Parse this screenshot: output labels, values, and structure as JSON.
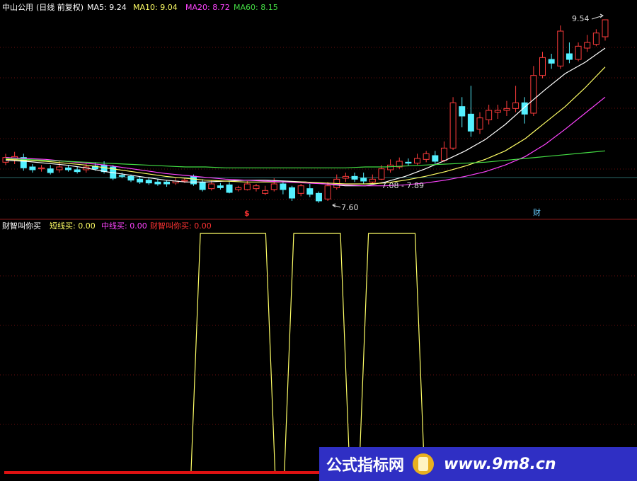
{
  "header": {
    "stock": "中山公用",
    "mode": "(日线 前复权)",
    "ma": [
      {
        "label": "MA5:",
        "value": "9.24",
        "color": "#ffffff"
      },
      {
        "label": "MA10:",
        "value": "9.04",
        "color": "#ffff66"
      },
      {
        "label": "MA20:",
        "value": "8.72",
        "color": "#ff44ff"
      },
      {
        "label": "MA60:",
        "value": "8.15",
        "color": "#44dd44"
      }
    ]
  },
  "indicator_header": {
    "name": "财智叫你买",
    "items": [
      {
        "label": "短线买:",
        "value": "0.00",
        "color": "#ffff66"
      },
      {
        "label": "中线买:",
        "value": "0.00",
        "color": "#ff44ff"
      },
      {
        "label": "财智叫你买:",
        "value": "0.00",
        "color": "#ff3333"
      }
    ]
  },
  "annotations": {
    "high": "9.54",
    "low": "7.60",
    "range": "7.08 - 7.89",
    "marker_sell": "$",
    "marker_buy": "财"
  },
  "watermark": {
    "cn": "公式指标网",
    "url": "www.9m8.cn"
  },
  "chart_data": [
    {
      "type": "line",
      "title": "中山公用 (日线 前复权)",
      "series": [
        {
          "name": "MA5",
          "color": "#ffffff",
          "values": [
            8.05,
            8.04,
            8.02,
            8.0,
            7.97,
            7.93,
            7.9,
            7.87,
            7.84,
            7.82,
            7.82,
            7.83,
            7.84,
            7.84,
            7.83,
            7.82,
            7.8,
            7.78,
            7.78,
            7.82,
            7.88,
            7.96,
            8.05,
            8.15,
            8.27,
            8.43,
            8.62,
            8.8,
            8.97,
            9.09,
            9.24
          ]
        },
        {
          "name": "MA10",
          "color": "#ffff66",
          "values": [
            8.06,
            8.05,
            8.04,
            8.02,
            8.0,
            7.97,
            7.94,
            7.91,
            7.88,
            7.86,
            7.84,
            7.83,
            7.82,
            7.82,
            7.82,
            7.82,
            7.81,
            7.8,
            7.8,
            7.81,
            7.84,
            7.88,
            7.93,
            7.99,
            8.06,
            8.15,
            8.28,
            8.45,
            8.62,
            8.82,
            9.04
          ]
        },
        {
          "name": "MA20",
          "color": "#ff44ff",
          "values": [
            8.08,
            8.07,
            8.06,
            8.04,
            8.02,
            8.0,
            7.97,
            7.94,
            7.91,
            7.89,
            7.87,
            7.85,
            7.84,
            7.83,
            7.82,
            7.81,
            7.8,
            7.79,
            7.78,
            7.78,
            7.79,
            7.81,
            7.84,
            7.88,
            7.93,
            8.0,
            8.09,
            8.22,
            8.38,
            8.55,
            8.72
          ]
        },
        {
          "name": "MA60",
          "color": "#44dd44",
          "values": [
            8.07,
            8.06,
            8.05,
            8.04,
            8.03,
            8.02,
            8.01,
            8.0,
            7.99,
            7.98,
            7.98,
            7.97,
            7.97,
            7.97,
            7.97,
            7.97,
            7.97,
            7.97,
            7.98,
            7.98,
            7.99,
            8.0,
            8.01,
            8.02,
            8.03,
            8.05,
            8.07,
            8.09,
            8.11,
            8.13,
            8.15
          ]
        }
      ],
      "candles": [
        [
          8.03,
          8.08,
          8.12,
          8.0
        ],
        [
          8.06,
          8.09,
          8.14,
          8.01
        ],
        [
          8.08,
          7.97,
          8.12,
          7.94
        ],
        [
          7.98,
          7.95,
          8.01,
          7.92
        ],
        [
          7.96,
          7.97,
          8.0,
          7.93
        ],
        [
          7.96,
          7.92,
          8.0,
          7.9
        ],
        [
          7.95,
          7.98,
          8.04,
          7.92
        ],
        [
          7.97,
          7.95,
          8.0,
          7.93
        ],
        [
          7.95,
          7.93,
          7.98,
          7.91
        ],
        [
          7.95,
          7.98,
          8.02,
          7.92
        ],
        [
          7.99,
          7.96,
          8.03,
          7.94
        ],
        [
          8.0,
          7.93,
          8.04,
          7.91
        ],
        [
          7.98,
          7.86,
          8.0,
          7.84
        ],
        [
          7.89,
          7.88,
          7.92,
          7.86
        ],
        [
          7.88,
          7.84,
          7.9,
          7.82
        ],
        [
          7.85,
          7.82,
          7.88,
          7.8
        ],
        [
          7.84,
          7.81,
          7.87,
          7.79
        ],
        [
          7.82,
          7.8,
          7.85,
          7.78
        ],
        [
          7.82,
          7.8,
          7.84,
          7.77
        ],
        [
          7.81,
          7.83,
          7.86,
          7.79
        ],
        [
          7.83,
          7.84,
          7.86,
          7.81
        ],
        [
          7.88,
          7.8,
          7.9,
          7.78
        ],
        [
          7.82,
          7.74,
          7.85,
          7.72
        ],
        [
          7.75,
          7.8,
          7.84,
          7.73
        ],
        [
          7.78,
          7.76,
          7.81,
          7.74
        ],
        [
          7.79,
          7.71,
          7.82,
          7.7
        ],
        [
          7.74,
          7.76,
          7.78,
          7.72
        ],
        [
          7.74,
          7.8,
          7.83,
          7.73
        ],
        [
          7.75,
          7.78,
          7.8,
          7.72
        ],
        [
          7.7,
          7.73,
          7.78,
          7.68
        ],
        [
          7.74,
          7.8,
          7.86,
          7.72
        ],
        [
          7.8,
          7.74,
          7.82,
          7.69
        ],
        [
          7.76,
          7.65,
          7.78,
          7.62
        ],
        [
          7.7,
          7.78,
          7.8,
          7.67
        ],
        [
          7.75,
          7.69,
          7.8,
          7.66
        ],
        [
          7.7,
          7.62,
          7.72,
          7.6
        ],
        [
          7.64,
          7.78,
          7.82,
          7.62
        ],
        [
          7.76,
          7.85,
          7.9,
          7.74
        ],
        [
          7.86,
          7.88,
          7.92,
          7.82
        ],
        [
          7.88,
          7.85,
          7.92,
          7.82
        ],
        [
          7.86,
          7.83,
          7.92,
          7.8
        ],
        [
          7.82,
          7.85,
          7.9,
          7.8
        ],
        [
          7.85,
          7.96,
          8.0,
          7.84
        ],
        [
          7.95,
          8.0,
          8.06,
          7.92
        ],
        [
          7.98,
          8.04,
          8.08,
          7.96
        ],
        [
          8.03,
          8.02,
          8.07,
          7.99
        ],
        [
          8.02,
          8.07,
          8.12,
          8.0
        ],
        [
          8.06,
          8.12,
          8.15,
          8.03
        ],
        [
          8.1,
          8.04,
          8.15,
          8.0
        ],
        [
          8.05,
          8.18,
          8.25,
          8.03
        ],
        [
          8.18,
          8.66,
          8.72,
          8.16
        ],
        [
          8.62,
          8.52,
          8.72,
          8.4
        ],
        [
          8.54,
          8.36,
          8.84,
          8.3
        ],
        [
          8.38,
          8.5,
          8.56,
          8.33
        ],
        [
          8.48,
          8.58,
          8.64,
          8.43
        ],
        [
          8.56,
          8.58,
          8.64,
          8.49
        ],
        [
          8.58,
          8.6,
          8.68,
          8.52
        ],
        [
          8.6,
          8.66,
          8.84,
          8.56
        ],
        [
          8.66,
          8.54,
          8.72,
          8.44
        ],
        [
          8.55,
          8.95,
          9.05,
          8.52
        ],
        [
          8.95,
          9.14,
          9.2,
          8.92
        ],
        [
          9.12,
          9.08,
          9.18,
          9.02
        ],
        [
          9.05,
          9.42,
          9.48,
          9.02
        ],
        [
          9.18,
          9.12,
          9.3,
          9.08
        ],
        [
          9.12,
          9.26,
          9.3,
          9.1
        ],
        [
          9.24,
          9.3,
          9.38,
          9.2
        ],
        [
          9.28,
          9.4,
          9.44,
          9.26
        ],
        [
          9.36,
          9.54,
          9.54,
          9.32
        ]
      ],
      "ylim": [
        7.5,
        9.6
      ]
    },
    {
      "type": "line",
      "title": "财智叫你买",
      "series": [
        {
          "name": "短线买",
          "color": "#ffff66",
          "values": [
            0,
            0,
            0,
            0,
            0,
            0,
            0,
            0,
            0,
            0,
            0,
            0,
            0,
            0,
            0,
            0,
            0,
            0,
            0,
            0,
            0,
            1,
            1,
            1,
            1,
            1,
            1,
            1,
            1,
            0,
            0,
            1,
            1,
            1,
            1,
            1,
            1,
            0,
            0,
            1,
            1,
            1,
            1,
            1,
            1,
            0,
            0,
            0,
            0,
            0,
            0,
            0,
            0,
            0,
            0,
            0,
            0,
            0,
            0,
            0,
            0,
            0,
            0,
            0,
            0,
            0,
            0,
            0
          ]
        },
        {
          "name": "财智叫你买",
          "color": "#dd1111",
          "values": [
            0,
            0,
            0,
            0,
            0,
            0,
            0,
            0,
            0,
            0,
            0,
            0,
            0,
            0,
            0,
            0,
            0,
            0,
            0,
            0,
            0,
            0,
            0,
            0,
            0,
            0,
            0,
            0,
            0,
            0,
            0,
            0,
            0,
            0,
            0,
            0,
            0,
            0,
            0,
            0,
            0,
            0,
            0,
            0,
            0,
            0,
            0,
            0,
            0,
            0,
            0,
            0,
            0,
            0,
            0,
            0,
            0,
            0,
            0,
            0,
            0,
            0,
            0,
            0,
            0,
            0,
            0,
            0
          ]
        }
      ],
      "ylim": [
        0,
        1
      ]
    }
  ]
}
